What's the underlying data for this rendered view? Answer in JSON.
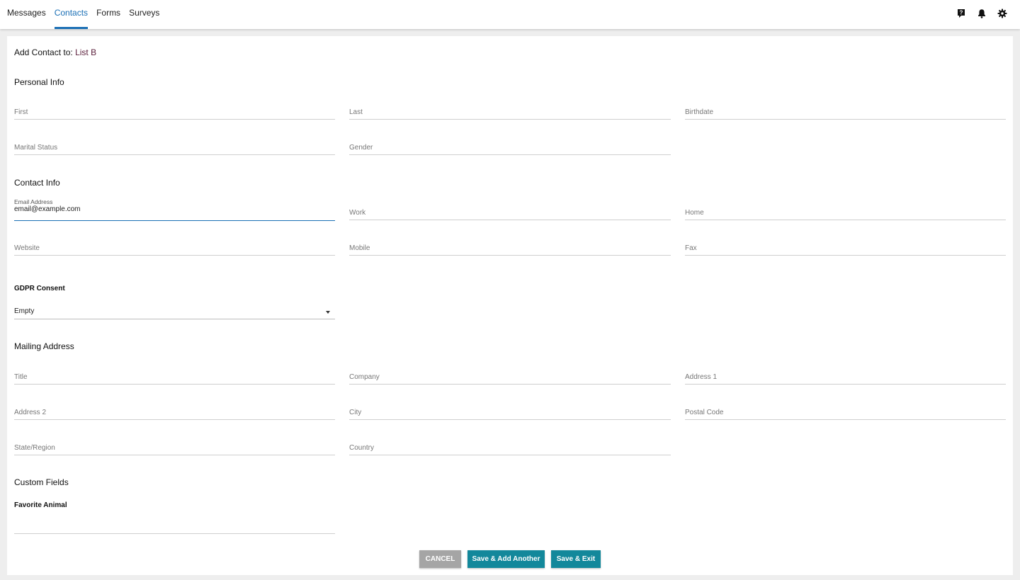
{
  "nav": {
    "tabs": [
      {
        "label": "Messages",
        "active": false
      },
      {
        "label": "Contacts",
        "active": true
      },
      {
        "label": "Forms",
        "active": false
      },
      {
        "label": "Surveys",
        "active": false
      }
    ],
    "icons": [
      "help-icon",
      "bell-icon",
      "gear-icon"
    ],
    "accent_color": "#1a6fb5"
  },
  "page": {
    "title_prefix": "Add Contact to:",
    "list_name": "List B"
  },
  "sections": {
    "personal": {
      "title": "Personal Info",
      "first": "First",
      "last": "Last",
      "birthdate": "Birthdate",
      "marital_status": "Marital Status",
      "gender": "Gender"
    },
    "contact": {
      "title": "Contact Info",
      "email_label": "Email Address",
      "email_value": "email@example.com",
      "work": "Work",
      "home": "Home",
      "website": "Website",
      "mobile": "Mobile",
      "fax": "Fax"
    },
    "gdpr": {
      "label": "GDPR Consent",
      "selected": "Empty"
    },
    "mailing": {
      "title": "Mailing Address",
      "title_field": "Title",
      "company": "Company",
      "address1": "Address 1",
      "address2": "Address 2",
      "city": "City",
      "postal_code": "Postal Code",
      "state_region": "State/Region",
      "country": "Country"
    },
    "custom": {
      "title": "Custom Fields",
      "favorite_animal_label": "Favorite Animal",
      "favorite_animal_value": ""
    }
  },
  "buttons": {
    "cancel": "CANCEL",
    "save_add": "Save & Add Another",
    "save_exit": "Save & Exit",
    "primary_color": "#13889b",
    "cancel_color": "#a5a5a5"
  }
}
